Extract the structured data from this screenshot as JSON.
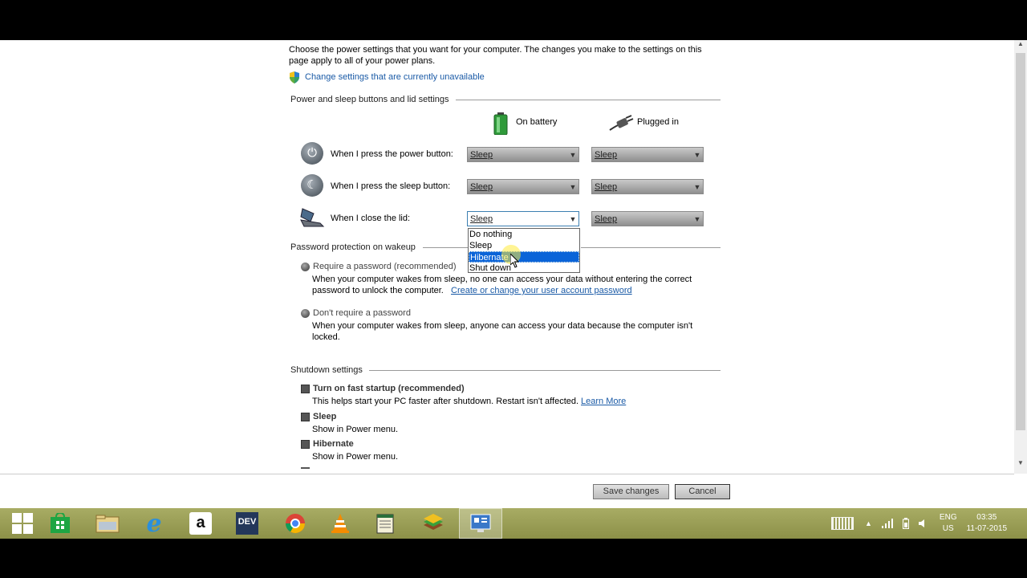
{
  "intro": {
    "line1": "Choose the power settings that you want for your computer. The changes you make to the settings on this",
    "line2": "page apply to all of your power plans.",
    "change_link": "Change settings that are currently unavailable"
  },
  "buttons_section": {
    "heading": "Power and sleep buttons and lid settings",
    "col_battery": "On battery",
    "col_plugged": "Plugged in",
    "rows": [
      {
        "label": "When I press the power button:",
        "battery": "Sleep",
        "plugged": "Sleep"
      },
      {
        "label": "When I press the sleep button:",
        "battery": "Sleep",
        "plugged": "Sleep"
      },
      {
        "label": "When I close the lid:",
        "battery": "Sleep",
        "plugged": "Sleep"
      }
    ],
    "dropdown_options": [
      "Do nothing",
      "Sleep",
      "Hibernate",
      "Shut down"
    ],
    "dropdown_highlighted": "Hibernate"
  },
  "password_section": {
    "heading": "Password protection on wakeup",
    "require_label": "Require a password (recommended)",
    "require_desc1": "When your computer wakes from sleep, no one can access your data without entering the correct",
    "require_desc2": "password to unlock the computer.",
    "require_link": "Create or change your user account password",
    "norequire_label": "Don't require a password",
    "norequire_desc1": "When your computer wakes from sleep, anyone can access your data because the computer isn't",
    "norequire_desc2": "locked."
  },
  "shutdown_section": {
    "heading": "Shutdown settings",
    "fast_startup_label": "Turn on fast startup (recommended)",
    "fast_startup_desc": "This helps start your PC faster after shutdown. Restart isn't affected.",
    "learn_more": "Learn More",
    "sleep_label": "Sleep",
    "sleep_desc": "Show in Power menu.",
    "hibernate_label": "Hibernate",
    "hibernate_desc": "Show in Power menu."
  },
  "footer": {
    "save": "Save changes",
    "cancel": "Cancel"
  },
  "taskbar": {
    "dev_label": "DEV",
    "lang": "ENG",
    "region": "US",
    "time": "03:35",
    "date": "11-07-2015"
  },
  "colors": {
    "link": "#1a5aa6",
    "selection": "#0a64d8",
    "taskbar": "#a0a45c"
  }
}
